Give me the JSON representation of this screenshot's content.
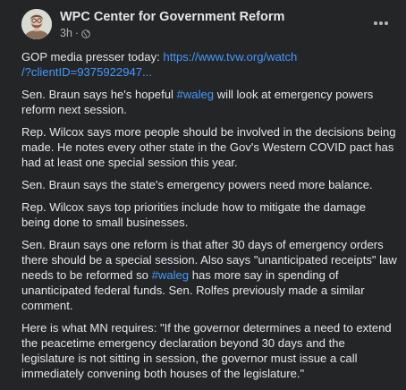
{
  "post": {
    "page_name": "WPC Center for Government Reform",
    "timestamp": "3h",
    "separator": "·",
    "audience_icon": "globe-icon",
    "more_icon": "more-options-icon",
    "colors": {
      "background": "#242526",
      "text": "#e4e6eb",
      "secondary_text": "#b0b3b8",
      "link": "#4599ff"
    },
    "paragraphs": [
      {
        "lead": "GOP media presser today: ",
        "link_line1": "https://www.tvw.org/watch",
        "link_line2": "/?clientID=9375922947..."
      },
      {
        "before": "Sen. Braun says he's hopeful ",
        "hashtag": "#waleg",
        "after": " will look at emergency powers reform next session."
      },
      {
        "text": "Rep. Wilcox says more people should be involved in the decisions being made. He notes every other state in the Gov's Western COVID pact has had at least one special session this year."
      },
      {
        "text": "Sen. Braun says the state's emergency powers need more balance."
      },
      {
        "text": "Rep. Wilcox says top priorities include how to mitigate the damage being done to small businesses."
      },
      {
        "before": "Sen. Braun says one reform is that after 30 days of emergency orders there should be a special session. Also says \"unanticipated receipts\" law needs to be reformed so ",
        "hashtag": "#waleg",
        "after": " has more say in spending of unanticipated federal funds. Sen. Rolfes previously made a similar comment."
      },
      {
        "text": "Here is what MN requires: \"If the governor determines a need to extend the peacetime emergency declaration beyond 30 days and the legislature is not sitting in session, the governor must issue a call immediately convening both houses of the legislature.\""
      }
    ]
  }
}
